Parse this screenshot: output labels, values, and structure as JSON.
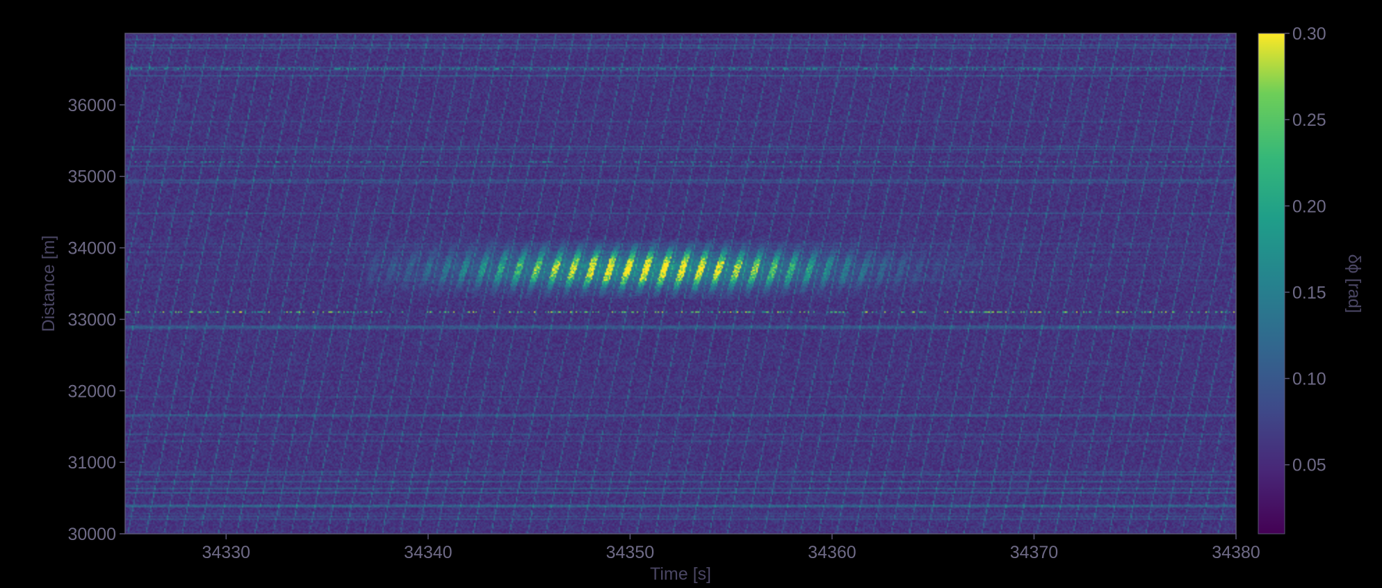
{
  "chart_data": {
    "type": "heatmap",
    "title": "",
    "xlabel": "Time [s]",
    "ylabel": "Distance [m]",
    "xlim": [
      34325,
      34380
    ],
    "ylim": [
      30000,
      37000
    ],
    "x_ticks": [
      34330,
      34340,
      34350,
      34360,
      34370,
      34380
    ],
    "y_ticks": [
      30000,
      31000,
      32000,
      33000,
      34000,
      35000,
      36000
    ],
    "colormap": "viridis",
    "colorbar": {
      "label": "δϕ [rad]",
      "range": [
        0.01,
        0.3
      ],
      "ticks": [
        0.05,
        0.1,
        0.15,
        0.2,
        0.25,
        0.3
      ],
      "tick_labels": [
        "0.05",
        "0.10",
        "0.15",
        "0.20",
        "0.25",
        "0.30"
      ]
    },
    "background_level": 0.06,
    "features": [
      {
        "kind": "strong_band",
        "distance_center": 33700,
        "distance_halfwidth": 300,
        "time_start": 34337,
        "time_end": 34372,
        "time_peak": 34351,
        "peak_value": 0.3
      },
      {
        "kind": "horizontal_line",
        "distance": 33100,
        "value": 0.28
      },
      {
        "kind": "horizontal_line",
        "distance": 36500,
        "value": 0.22
      },
      {
        "kind": "horizontal_line",
        "distance": 35200,
        "value": 0.18
      },
      {
        "kind": "diagonal_streaks",
        "value": 0.12,
        "spacing_s": 0.9
      }
    ],
    "grid": false,
    "legend": "none"
  }
}
